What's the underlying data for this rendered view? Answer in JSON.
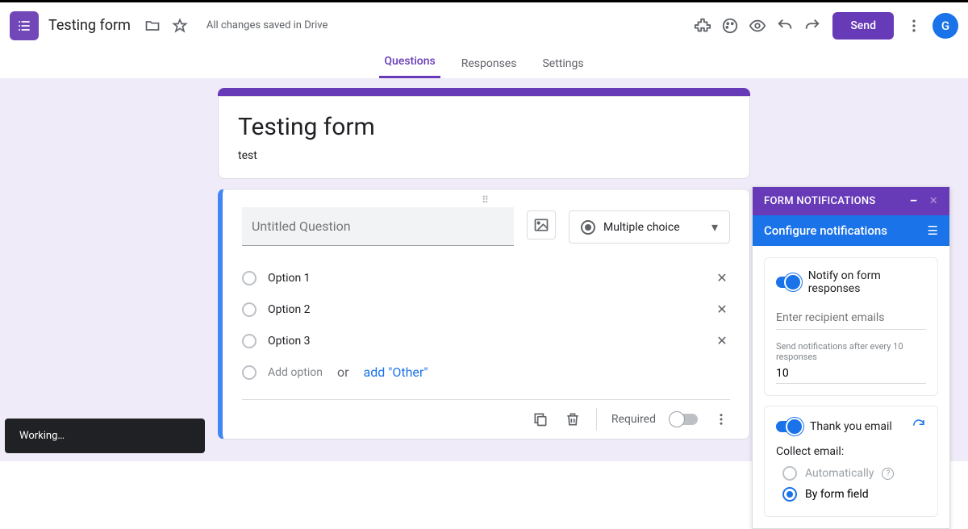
{
  "header": {
    "title": "Testing form",
    "status": "All changes saved in Drive",
    "send_label": "Send",
    "avatar_initial": "G"
  },
  "tabs": {
    "questions": "Questions",
    "responses": "Responses",
    "settings": "Settings"
  },
  "form": {
    "title": "Testing form",
    "description": "test"
  },
  "question": {
    "placeholder": "Untitled Question",
    "type_label": "Multiple choice",
    "options": [
      "Option 1",
      "Option 2",
      "Option 3"
    ],
    "add_option": "Add option",
    "or": "or",
    "add_other": "add \"Other\"",
    "required_label": "Required"
  },
  "addon": {
    "header": "FORM NOTIFICATIONS",
    "subheader": "Configure notifications",
    "notify_label": "Notify on form responses",
    "recipients_placeholder": "Enter recipient emails",
    "send_after_label": "Send notifications after every 10 responses",
    "send_after_value": "10",
    "thank_you_label": "Thank you email",
    "collect_label": "Collect email:",
    "auto_label": "Automatically",
    "by_field_label": "By form field"
  },
  "toast_text": "Working…"
}
